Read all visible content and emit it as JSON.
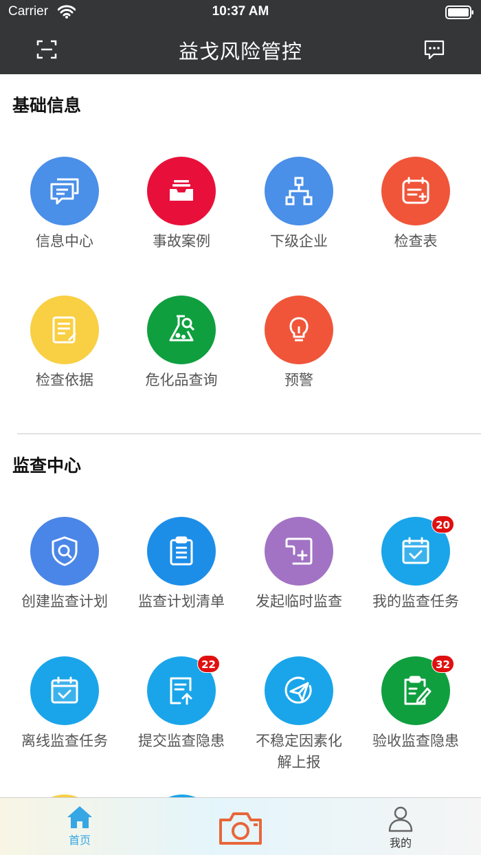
{
  "status_bar": {
    "carrier": "Carrier",
    "time": "10:37 AM"
  },
  "nav": {
    "title": "益戈风险管控"
  },
  "basic_info": {
    "title": "基础信息",
    "items": [
      {
        "label": "信息中心",
        "icon": "message-bubbles-icon",
        "color": "#4a8fe8"
      },
      {
        "label": "事故案例",
        "icon": "inbox-tray-icon",
        "color": "#e8103a"
      },
      {
        "label": "下级企业",
        "icon": "org-chart-icon",
        "color": "#4a8fe8"
      },
      {
        "label": "检查表",
        "icon": "calendar-note-icon",
        "color": "#f0553a"
      },
      {
        "label": "检查依据",
        "icon": "document-edit-icon",
        "color": "#f9cf43"
      },
      {
        "label": "危化品查询",
        "icon": "flask-search-icon",
        "color": "#0f9f3f"
      },
      {
        "label": "预警",
        "icon": "lightbulb-icon",
        "color": "#f0553a"
      }
    ]
  },
  "inspection_center": {
    "title": "监查中心",
    "items": [
      {
        "label": "创建监查计划",
        "icon": "shield-search-icon",
        "color": "#4a86e8",
        "badge": ""
      },
      {
        "label": "监查计划清单",
        "icon": "clipboard-list-icon",
        "color": "#1d8ee8",
        "badge": ""
      },
      {
        "label": "发起临时监查",
        "icon": "add-note-icon",
        "color": "#a273c4",
        "badge": ""
      },
      {
        "label": "我的监查任务",
        "icon": "calendar-check-icon",
        "color": "#1aa5ea",
        "badge": "20"
      },
      {
        "label": "离线监查任务",
        "icon": "calendar-check-icon",
        "color": "#1aa5ea",
        "badge": ""
      },
      {
        "label": "提交监查隐患",
        "icon": "upload-document-icon",
        "color": "#1aa5ea",
        "badge": "22"
      },
      {
        "label": "不稳定因素化解上报",
        "icon": "paper-plane-icon",
        "color": "#1aa5ea",
        "badge": ""
      },
      {
        "label": "验收监查隐患",
        "icon": "clipboard-pencil-icon",
        "color": "#0f9f3f",
        "badge": "32"
      }
    ]
  },
  "tab_bar": {
    "items": [
      {
        "label": "首页",
        "icon": "home-icon",
        "color": "#36a6e4"
      },
      {
        "label": "",
        "icon": "camera-icon",
        "color": "#e8663a"
      },
      {
        "label": "我的",
        "icon": "user-icon",
        "color": "#666666"
      }
    ]
  }
}
